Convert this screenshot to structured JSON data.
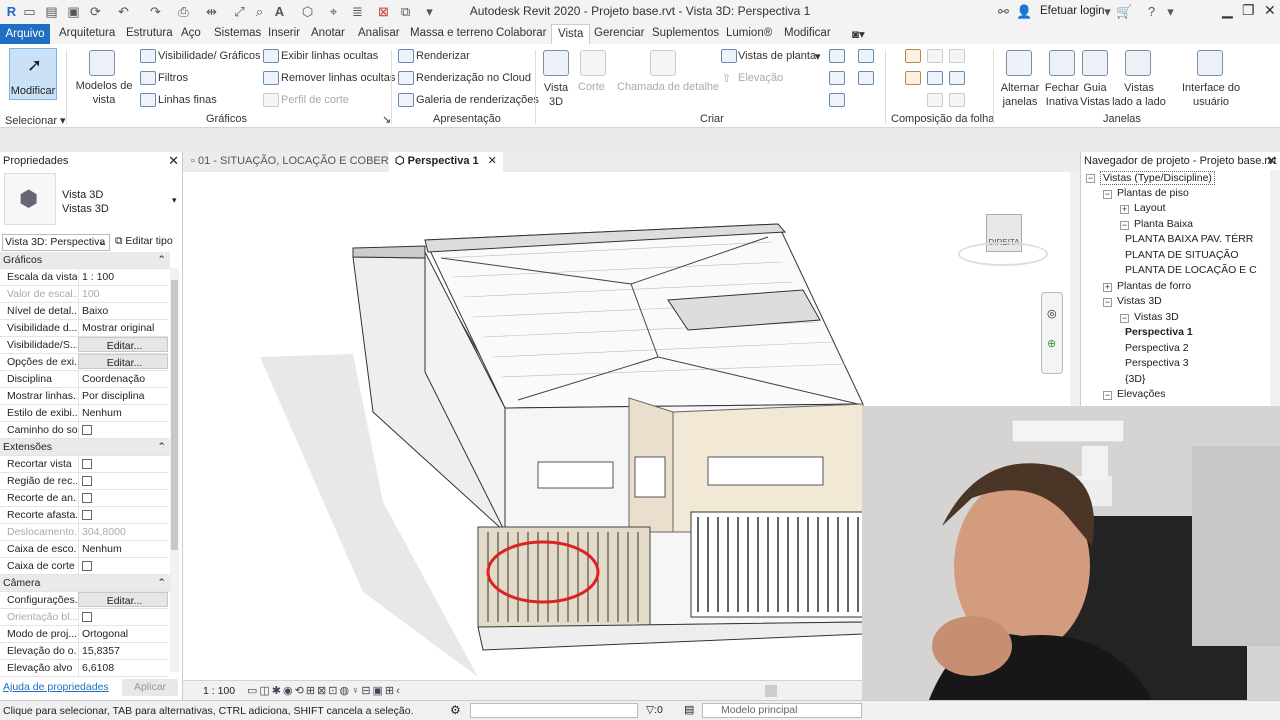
{
  "title": "Autodesk Revit 2020 - Projeto base.rvt - Vista 3D: Perspectiva 1",
  "login": "Efetuar login",
  "tabs": [
    "Arquivo",
    "Arquitetura",
    "Estrutura",
    "Aço",
    "Sistemas",
    "Inserir",
    "Anotar",
    "Analisar",
    "Massa e terreno",
    "Colaborar",
    "Vista",
    "Gerenciar",
    "Suplementos",
    "Lumion®",
    "Modificar"
  ],
  "ribbon": {
    "modify": "Modificar",
    "select": "Selecionar",
    "vista_modelos": "Modelos de\nvista",
    "visibilidade": "Visibilidade/ Gráficos",
    "filtros": "Filtros",
    "linhas_finas": "Linhas  finas",
    "exibir_linhas": "Exibir  linhas  ocultas",
    "remover_linhas": "Remover  linhas ocultas",
    "perfil_corte": "Perfil  de corte",
    "graficos": "Gráficos",
    "renderizar": "Renderizar",
    "render_cloud": "Renderização  no Cloud",
    "galeria": "Galeria  de renderizações",
    "apresentacao": "Apresentação",
    "vista3d": "Vista\n3D",
    "corte": "Corte",
    "chamada": "Chamada de detalhe",
    "vistas_planta": "Vistas  de  planta",
    "elevacao": "Elevação",
    "criar": "Criar",
    "composicao": "Composição da folha",
    "alternar": "Alternar\njanelas",
    "fechar": "Fechar\nInativa",
    "guia": "Guia\nVistas",
    "lado": "Vistas\nlado a lado",
    "interface": "Interface do\nusuário",
    "janelas": "Janelas"
  },
  "properties": {
    "header": "Propriedades",
    "type1": "Vista 3D",
    "type2": "Vistas 3D",
    "selector": "Vista 3D: Perspectiva",
    "edit_type": "Editar tipo",
    "help": "Ajuda de propriedades",
    "apply": "Aplicar",
    "sections": {
      "graficos": "Gráficos",
      "extensoes": "Extensões",
      "camera": "Câmera"
    },
    "rows": [
      {
        "k": "Escala da vista",
        "v": "1 : 100"
      },
      {
        "k": "Valor de escal...",
        "v": "100",
        "dis": true
      },
      {
        "k": "Nível de detal...",
        "v": "Baixo"
      },
      {
        "k": "Visibilidade d...",
        "v": "Mostrar original"
      },
      {
        "k": "Visibilidade/S...",
        "v": "Editar...",
        "btn": true
      },
      {
        "k": "Opções de exi...",
        "v": "Editar...",
        "btn": true
      },
      {
        "k": "Disciplina",
        "v": "Coordenação"
      },
      {
        "k": "Mostrar linhas...",
        "v": "Por disciplina"
      },
      {
        "k": "Estilo de exibi...",
        "v": "Nenhum"
      },
      {
        "k": "Caminho do sol",
        "v": "",
        "chk": true
      },
      {
        "k": "Recortar vista",
        "v": "",
        "chk": true
      },
      {
        "k": "Região de rec...",
        "v": "",
        "chk": true
      },
      {
        "k": "Recorte de an...",
        "v": "",
        "chk": true
      },
      {
        "k": "Recorte afasta...",
        "v": "",
        "chk": true
      },
      {
        "k": "Deslocamento...",
        "v": "304,8000",
        "dis": true
      },
      {
        "k": "Caixa de esco...",
        "v": "Nenhum"
      },
      {
        "k": "Caixa de corte",
        "v": "",
        "chk": true
      },
      {
        "k": "Configurações...",
        "v": "Editar...",
        "btn": true
      },
      {
        "k": "Orientação bl...",
        "v": "",
        "chk": true,
        "dis": true
      },
      {
        "k": "Modo de proj...",
        "v": "Ortogonal"
      },
      {
        "k": "Elevação do o...",
        "v": "15,8357"
      },
      {
        "k": "Elevação alvo",
        "v": "6,6108"
      }
    ]
  },
  "view_tabs": [
    "01 - SITUAÇÃO, LOCAÇÃO E COBER...",
    "Perspectiva 1"
  ],
  "viewcube": "DIREITA",
  "view_scale": "1 : 100",
  "browser": {
    "header": "Navegador de projeto - Projeto base.rvt",
    "nodes": [
      "Vistas (Type/Discipline)",
      "Plantas de piso",
      "Layout",
      "Planta Baixa",
      "PLANTA BAIXA PAV. TÉRR",
      "PLANTA DE SITUAÇÃO",
      "PLANTA DE LOCAÇÃO E C",
      "Plantas de forro",
      "Vistas 3D",
      "Vistas 3D",
      "Perspectiva 1",
      "Perspectiva 2",
      "Perspectiva 3",
      "{3D}",
      "Elevações"
    ]
  },
  "status": {
    "hint": "Clique para selecionar, TAB para alternativas, CTRL adiciona, SHIFT cancela a seleção.",
    "count": ":0",
    "model": "Modelo principal"
  }
}
